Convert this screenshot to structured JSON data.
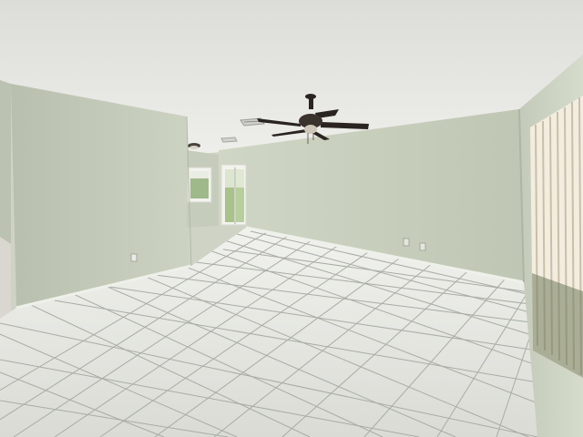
{
  "scene": {
    "type": "interior-photo",
    "subject": "empty room",
    "elements": [
      "ceiling-fan",
      "tile-floor",
      "window-blinds",
      "sliding-door",
      "air-vent",
      "ceiling-light",
      "electrical-outlet"
    ]
  },
  "colors": {
    "ceiling": "#e6e6e2",
    "wall_left": "#c9cfbe",
    "wall_back": "#c3cab8",
    "wall_right": "#cfd5c5",
    "floor": "#e8e9e4",
    "grout": "#a8aaa4",
    "fan": "#2a2420",
    "blinds": "#e9dfc8"
  }
}
